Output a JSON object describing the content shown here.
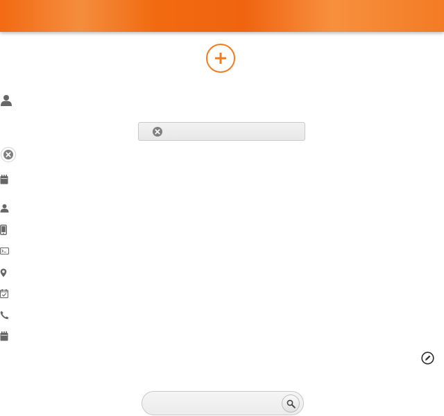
{
  "header": {
    "color_primary": "#f37b1e"
  },
  "add_button": {
    "icon": "plus-circle-icon"
  },
  "search_field": {
    "value": "",
    "placeholder": ""
  },
  "side_icons": [
    "user-icon",
    "clear-circle-icon",
    "calendar-icon",
    "user-small-icon",
    "mobile-phone-icon",
    "terminal-icon",
    "location-pin-icon",
    "calendar-check-icon",
    "phone-icon",
    "calendar-small-icon"
  ],
  "edit_button": {
    "icon": "edit-icon"
  },
  "bottom_search": {
    "value": "",
    "placeholder": "",
    "button_icon": "search-icon"
  }
}
